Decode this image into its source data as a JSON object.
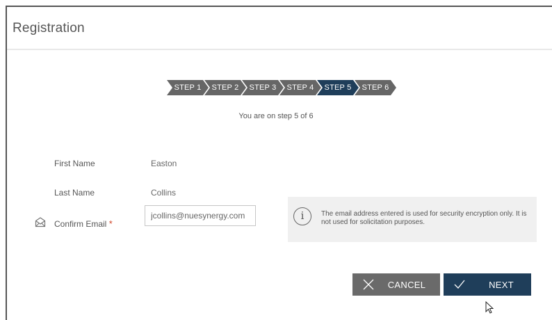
{
  "window": {
    "title": "Registration"
  },
  "stepper": {
    "steps": [
      "STEP 1",
      "STEP 2",
      "STEP 3",
      "STEP 4",
      "STEP 5",
      "STEP 6"
    ],
    "current": 5,
    "status_text": "You are on step 5 of 6"
  },
  "form": {
    "first_name": {
      "label": "First Name",
      "value": "Easton"
    },
    "last_name": {
      "label": "Last Name",
      "value": "Collins"
    },
    "confirm_email": {
      "label": "Confirm Email",
      "required_marker": "*",
      "value": "jcollins@nuesynergy.com",
      "icon": "envelope-icon"
    }
  },
  "info": {
    "icon": "info-icon",
    "glyph": "i",
    "text": "The email address entered is used for security encryption only. It is not used for solicitation purposes."
  },
  "buttons": {
    "cancel": {
      "label": "CANCEL",
      "icon": "x-icon"
    },
    "next": {
      "label": "NEXT",
      "icon": "checkmark-icon"
    }
  },
  "colors": {
    "step_inactive": "#666666",
    "step_active": "#1f3e5a",
    "required": "#d0472b",
    "cancel_button": "#6a6a6a",
    "next_button": "#1f3e5a",
    "info_background": "#f0f0f0"
  }
}
